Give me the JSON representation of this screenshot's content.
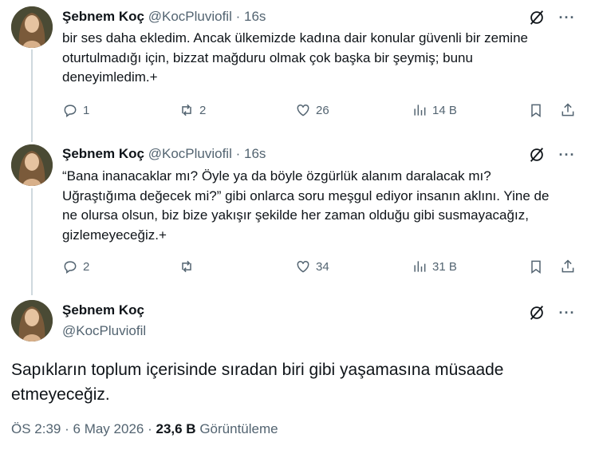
{
  "tweets": [
    {
      "name": "Şebnem Koç",
      "handle": "@KocPluviofil",
      "time": "16s",
      "text": "bir ses daha ekledim. Ancak ülkemizde kadına dair konular güvenli bir zemine oturtulmadığı için, bizzat mağduru olmak çok başka bir şeymiş; bunu deneyimledim.+",
      "replies": "1",
      "reposts": "2",
      "likes": "26",
      "views": "14 B"
    },
    {
      "name": "Şebnem Koç",
      "handle": "@KocPluviofil",
      "time": "16s",
      "text": "“Bana inanacaklar mı? Öyle ya da böyle özgürlük alanım daralacak mı? Uğraştığıma değecek mi?” gibi onlarca soru meşgul ediyor insanın aklını. Yine de ne olursa olsun, biz bize yakışır şekilde her zaman olduğu gibi susmayacağız, gizlemeyeceğiz.+",
      "replies": "2",
      "reposts": "",
      "likes": "34",
      "views": "31 B"
    }
  ],
  "main": {
    "name": "Şebnem Koç",
    "handle": "@KocPluviofil",
    "text": "Sapıkların toplum içerisinde sıradan biri gibi yaşamasına müsaade etmeyeceğiz.",
    "time": "ÖS 2:39",
    "separator": "·",
    "date": "6 May 2026",
    "views_count": "23,6 B",
    "views_label": "Görüntüleme"
  },
  "ui": {
    "dot": "·",
    "more": "···"
  },
  "icons": {
    "reply": "reply-icon",
    "repost": "repost-icon",
    "like": "heart-icon",
    "views": "views-bar-chart-icon",
    "bookmark": "bookmark-icon",
    "share": "share-icon",
    "grok": "grok-icon",
    "more": "more-icon"
  },
  "colors": {
    "text": "#0f1419",
    "secondary": "#536471",
    "thread_line": "#cfd9de"
  }
}
